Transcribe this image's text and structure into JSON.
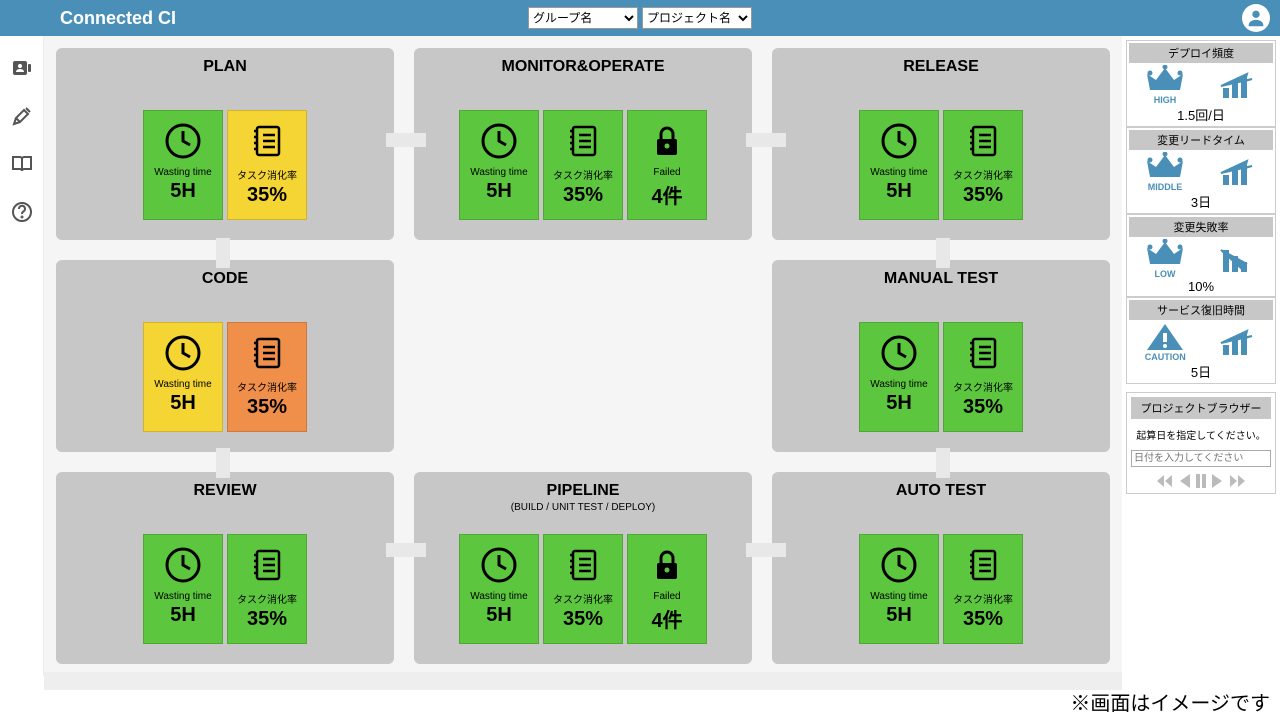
{
  "header": {
    "logo": "Connected CI",
    "group_select": "グループ名",
    "project_select": "プロジェクト名"
  },
  "stages": [
    {
      "title": "PLAN",
      "sub": "",
      "metrics": [
        {
          "color": "green",
          "icon": "clock",
          "label": "Wasting time",
          "value": "5H"
        },
        {
          "color": "yellow",
          "icon": "notebook",
          "label": "タスク消化率",
          "value": "35%"
        }
      ]
    },
    {
      "title": "MONITOR&OPERATE",
      "sub": "",
      "metrics": [
        {
          "color": "green",
          "icon": "clock",
          "label": "Wasting time",
          "value": "5H"
        },
        {
          "color": "green",
          "icon": "notebook",
          "label": "タスク消化率",
          "value": "35%"
        },
        {
          "color": "green",
          "icon": "lock",
          "label": "Failed",
          "value": "4件"
        }
      ]
    },
    {
      "title": "RELEASE",
      "sub": "",
      "metrics": [
        {
          "color": "green",
          "icon": "clock",
          "label": "Wasting time",
          "value": "5H"
        },
        {
          "color": "green",
          "icon": "notebook",
          "label": "タスク消化率",
          "value": "35%"
        }
      ]
    },
    {
      "title": "CODE",
      "sub": "",
      "metrics": [
        {
          "color": "yellow",
          "icon": "clock",
          "label": "Wasting time",
          "value": "5H"
        },
        {
          "color": "orange",
          "icon": "notebook",
          "label": "タスク消化率",
          "value": "35%"
        }
      ]
    },
    {
      "title": "",
      "sub": "",
      "empty": true,
      "metrics": []
    },
    {
      "title": "MANUAL TEST",
      "sub": "",
      "metrics": [
        {
          "color": "green",
          "icon": "clock",
          "label": "Wasting time",
          "value": "5H"
        },
        {
          "color": "green",
          "icon": "notebook",
          "label": "タスク消化率",
          "value": "35%"
        }
      ]
    },
    {
      "title": "REVIEW",
      "sub": "",
      "metrics": [
        {
          "color": "green",
          "icon": "clock",
          "label": "Wasting time",
          "value": "5H"
        },
        {
          "color": "green",
          "icon": "notebook",
          "label": "タスク消化率",
          "value": "35%"
        }
      ]
    },
    {
      "title": "PIPELINE",
      "sub": "(BUILD / UNIT TEST / DEPLOY)",
      "metrics": [
        {
          "color": "green",
          "icon": "clock",
          "label": "Wasting time",
          "value": "5H"
        },
        {
          "color": "green",
          "icon": "notebook",
          "label": "タスク消化率",
          "value": "35%"
        },
        {
          "color": "green",
          "icon": "lock",
          "label": "Failed",
          "value": "4件"
        }
      ]
    },
    {
      "title": "AUTO TEST",
      "sub": "",
      "metrics": [
        {
          "color": "green",
          "icon": "clock",
          "label": "Wasting time",
          "value": "5H"
        },
        {
          "color": "green",
          "icon": "notebook",
          "label": "タスク消化率",
          "value": "35%"
        }
      ]
    }
  ],
  "kpis": [
    {
      "title": "デプロイ頻度",
      "badge": "HIGH",
      "badge_icon": "crown",
      "trend": "up",
      "value": "1.5回/日"
    },
    {
      "title": "変更リードタイム",
      "badge": "MIDDLE",
      "badge_icon": "crown",
      "trend": "up",
      "value": "3日"
    },
    {
      "title": "変更失敗率",
      "badge": "LOW",
      "badge_icon": "crown",
      "trend": "down",
      "value": "10%"
    },
    {
      "title": "サービス復旧時間",
      "badge": "CAUTION",
      "badge_icon": "warning",
      "trend": "up",
      "value": "5日"
    }
  ],
  "browser": {
    "title": "プロジェクトブラウザー",
    "hint": "起算日を指定してください。",
    "placeholder": "日付を入力してください"
  },
  "note": "※画面はイメージです"
}
